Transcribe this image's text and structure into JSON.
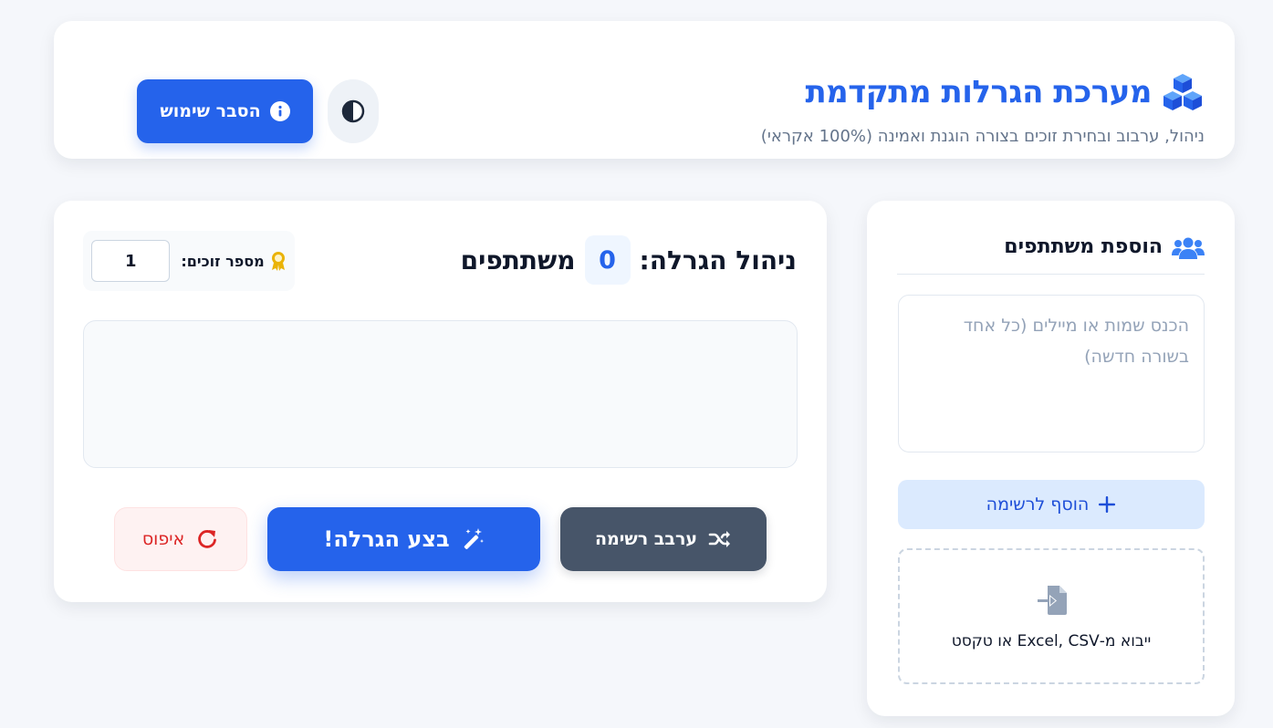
{
  "header": {
    "title": "מערכת הגרלות מתקדמת",
    "subtitle": "ניהול, ערבוב ובחירת זוכים בצורה הוגנת ואמינה (100% אקראי)",
    "help_button_label": "הסבר שימוש",
    "title_icon": "cubes-icon",
    "theme_icon": "half-circle-icon"
  },
  "participants": {
    "title": "הוספת משתתפים",
    "textarea_placeholder": "הכנס שמות או מיילים (כל אחד בשורה חדשה)",
    "textarea_value": "",
    "add_button_label": "הוסף לרשימה",
    "import_label": "ייבוא מ-Excel, CSV או טקסט"
  },
  "lottery": {
    "title": "ניהול הגרלה:",
    "count": "0",
    "count_suffix": "משתתפים",
    "winners_label": "מספר זוכים:",
    "winners_value": "1",
    "shuffle_label": "ערבב רשימה",
    "draw_label": "בצע הגרלה!",
    "reset_label": "איפוס"
  },
  "colors": {
    "primary": "#2563eb",
    "secondary": "#475569",
    "danger": "#dc2626",
    "medal": "#eab308"
  }
}
